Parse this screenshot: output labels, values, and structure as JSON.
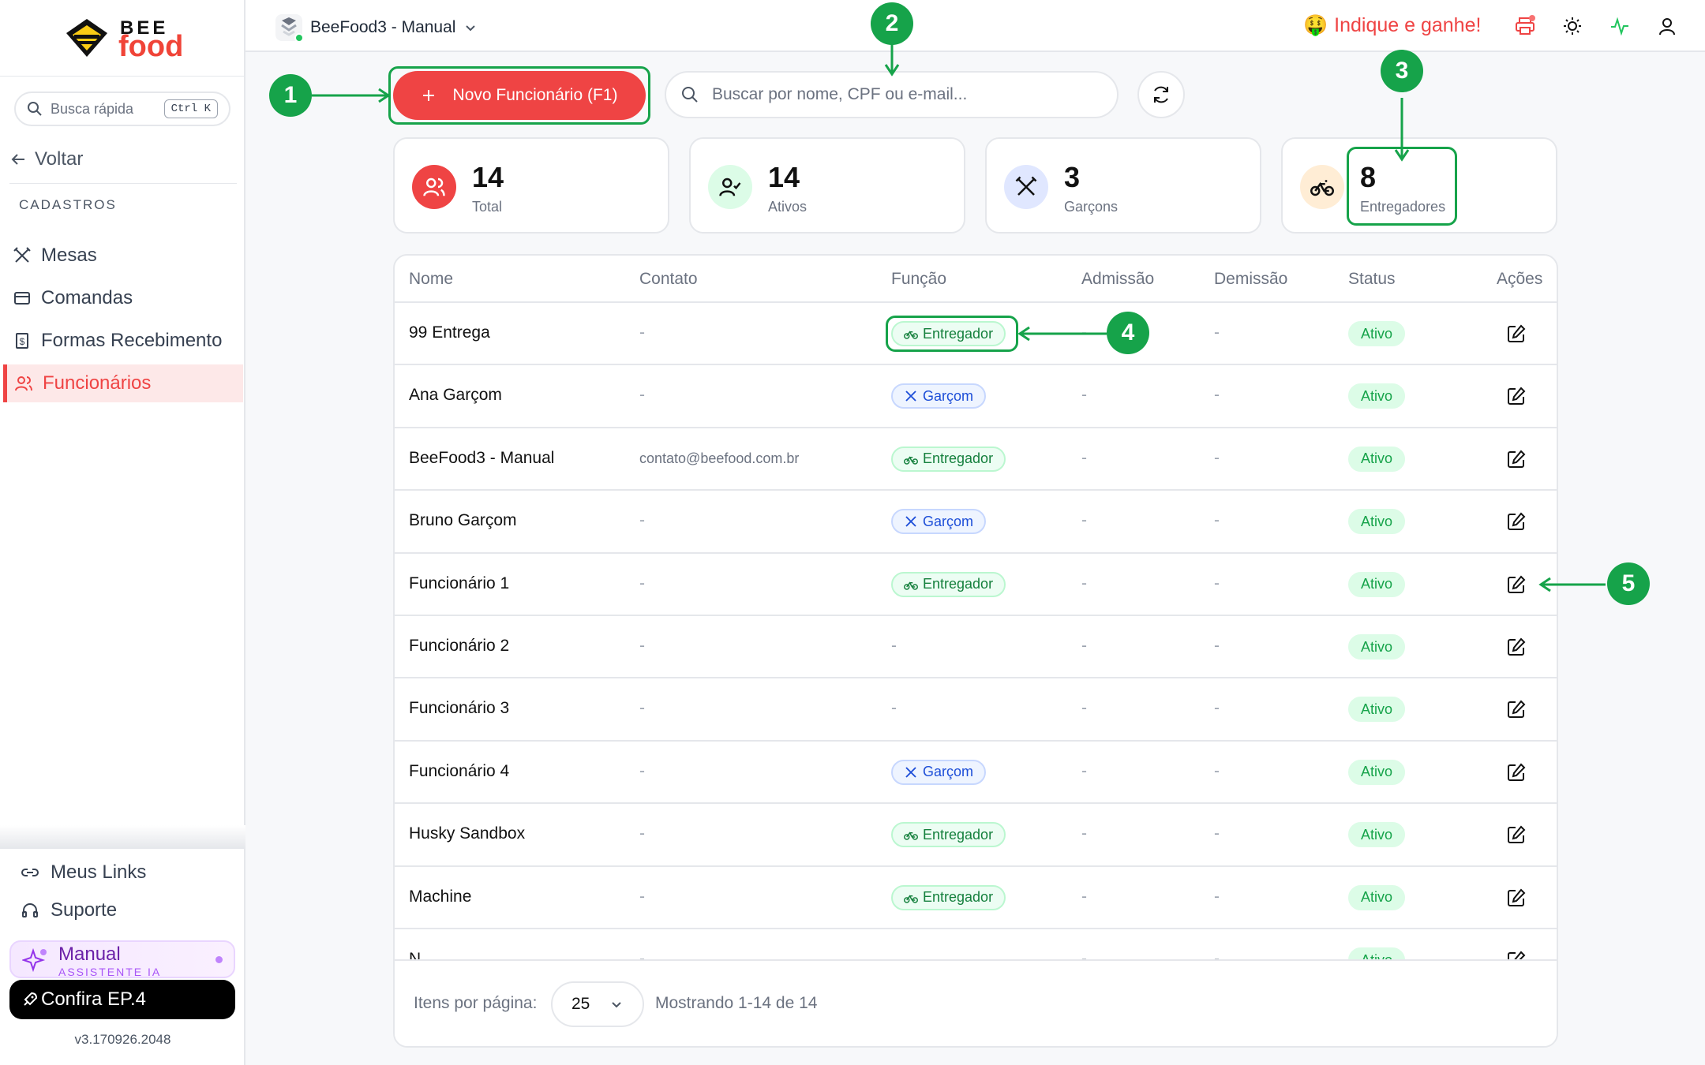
{
  "sidebar": {
    "logo_top": "BEE",
    "logo_bottom": "food",
    "quick_search": "Busca rápida",
    "quick_search_kbd": "Ctrl K",
    "back": "Voltar",
    "section": "CADASTROS",
    "items": [
      {
        "label": "Mesas",
        "icon": "utensils-crossed-icon"
      },
      {
        "label": "Comandas",
        "icon": "card-icon"
      },
      {
        "label": "Formas Recebimento",
        "icon": "receipt-dollar-icon"
      },
      {
        "label": "Funcionários",
        "icon": "users-icon",
        "active": true
      }
    ],
    "bottom_links": [
      {
        "label": "Meus Links",
        "icon": "link-icon"
      },
      {
        "label": "Suporte",
        "icon": "headset-icon"
      }
    ],
    "ai_title": "Manual",
    "ai_subtitle": "ASSISTENTE IA",
    "ep_label": "Confira EP.4",
    "version": "v3.170926.2048"
  },
  "topbar": {
    "store_name": "BeeFood3 - Manual",
    "refer": "Indique e ganhe!",
    "refer_emoji": "🤑"
  },
  "toolbar": {
    "new_button": "Novo Funcionário (F1)",
    "search_placeholder": "Buscar por nome, CPF ou e-mail..."
  },
  "stats": [
    {
      "value": "14",
      "label": "Total",
      "color": "#ef4444"
    },
    {
      "value": "14",
      "label": "Ativos",
      "color": "#dcfce7"
    },
    {
      "value": "3",
      "label": "Garçons",
      "color": "#e0e7ff"
    },
    {
      "value": "8",
      "label": "Entregadores",
      "color": "#ffedd5"
    }
  ],
  "table": {
    "headers": [
      "Nome",
      "Contato",
      "Função",
      "Admissão",
      "Demissão",
      "Status",
      "Ações"
    ],
    "rows": [
      {
        "name": "99 Entrega",
        "contact": "-",
        "role": "Entregador",
        "adm": "-",
        "dem": "-",
        "status": "Ativo"
      },
      {
        "name": "Ana Garçom",
        "contact": "-",
        "role": "Garçom",
        "adm": "-",
        "dem": "-",
        "status": "Ativo"
      },
      {
        "name": "BeeFood3 - Manual",
        "contact": "contato@beefood.com.br",
        "role": "Entregador",
        "adm": "-",
        "dem": "-",
        "status": "Ativo"
      },
      {
        "name": "Bruno Garçom",
        "contact": "-",
        "role": "Garçom",
        "adm": "-",
        "dem": "-",
        "status": "Ativo"
      },
      {
        "name": "Funcionário 1",
        "contact": "-",
        "role": "Entregador",
        "adm": "-",
        "dem": "-",
        "status": "Ativo"
      },
      {
        "name": "Funcionário 2",
        "contact": "-",
        "role": "-",
        "adm": "-",
        "dem": "-",
        "status": "Ativo"
      },
      {
        "name": "Funcionário 3",
        "contact": "-",
        "role": "-",
        "adm": "-",
        "dem": "-",
        "status": "Ativo"
      },
      {
        "name": "Funcionário 4",
        "contact": "-",
        "role": "Garçom",
        "adm": "-",
        "dem": "-",
        "status": "Ativo"
      },
      {
        "name": "Husky Sandbox",
        "contact": "-",
        "role": "Entregador",
        "adm": "-",
        "dem": "-",
        "status": "Ativo"
      },
      {
        "name": "Machine",
        "contact": "-",
        "role": "Entregador",
        "adm": "-",
        "dem": "-",
        "status": "Ativo"
      },
      {
        "name": "N",
        "contact": "-",
        "role": "",
        "adm": "-",
        "dem": "-",
        "status": "Ativo"
      }
    ],
    "per_page_label": "Itens por página:",
    "per_page": "25",
    "showing": "Mostrando 1-14 de 14"
  },
  "callouts": [
    "1",
    "2",
    "3",
    "4",
    "5"
  ],
  "colors": {
    "accent": "#ef4444",
    "annotation": "#16a34a"
  }
}
